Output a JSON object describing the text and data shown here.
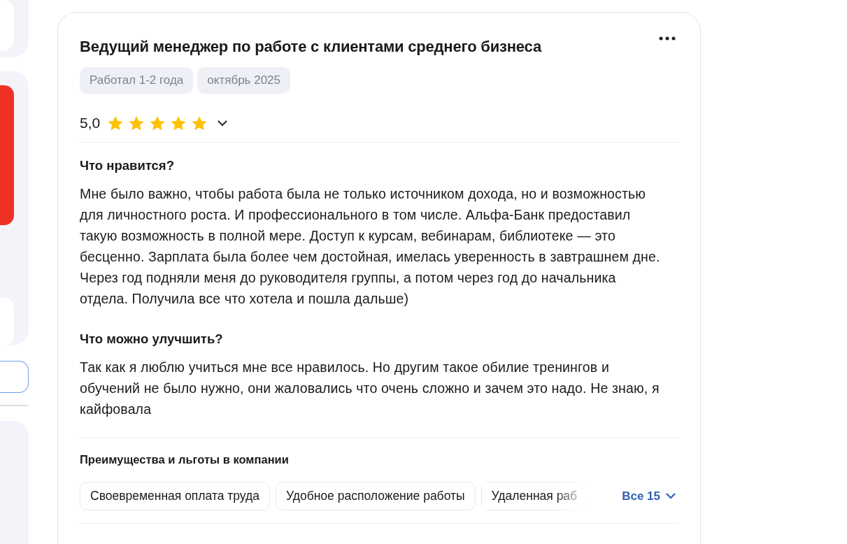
{
  "review": {
    "title": "Ведущий менеджер по работе с клиентами среднего бизнеса",
    "tags": [
      "Работал 1-2 года",
      "октябрь 2025"
    ],
    "rating": {
      "value": "5,0",
      "stars": 5
    },
    "sections": [
      {
        "heading": "Что нравится?",
        "lines": [
          "Мне было важно, чтобы работа была не только источником дохода, но и возможностью",
          "для личностного роста. И профессионального в том числе. Альфа-Банк предоставил",
          "такую возможность в полной мере. Доступ к курсам, вебинарам, библиотеке — это",
          "бесценно. Зарплата была более чем достойная, имелась уверенность в завтрашнем дне.",
          "Через год подняли меня до руководителя группы, а потом через год до начальника",
          "отдела. Получила все что хотела и пошла дальше)"
        ]
      },
      {
        "heading": "Что можно улучшить?",
        "lines": [
          "Так как я люблю учиться мне все нравилось. Но другим такое обилие тренингов и",
          "обучений не было нужно, они жаловались что очень сложно и зачем это надо. Не знаю, я",
          "кайфовала"
        ]
      }
    ],
    "benefits": {
      "heading": "Преимущества и льготы в компании",
      "items": [
        "Своевременная оплата труда",
        "Удобное расположение работы",
        "Удаленная раб"
      ],
      "more": "Все 15"
    }
  }
}
